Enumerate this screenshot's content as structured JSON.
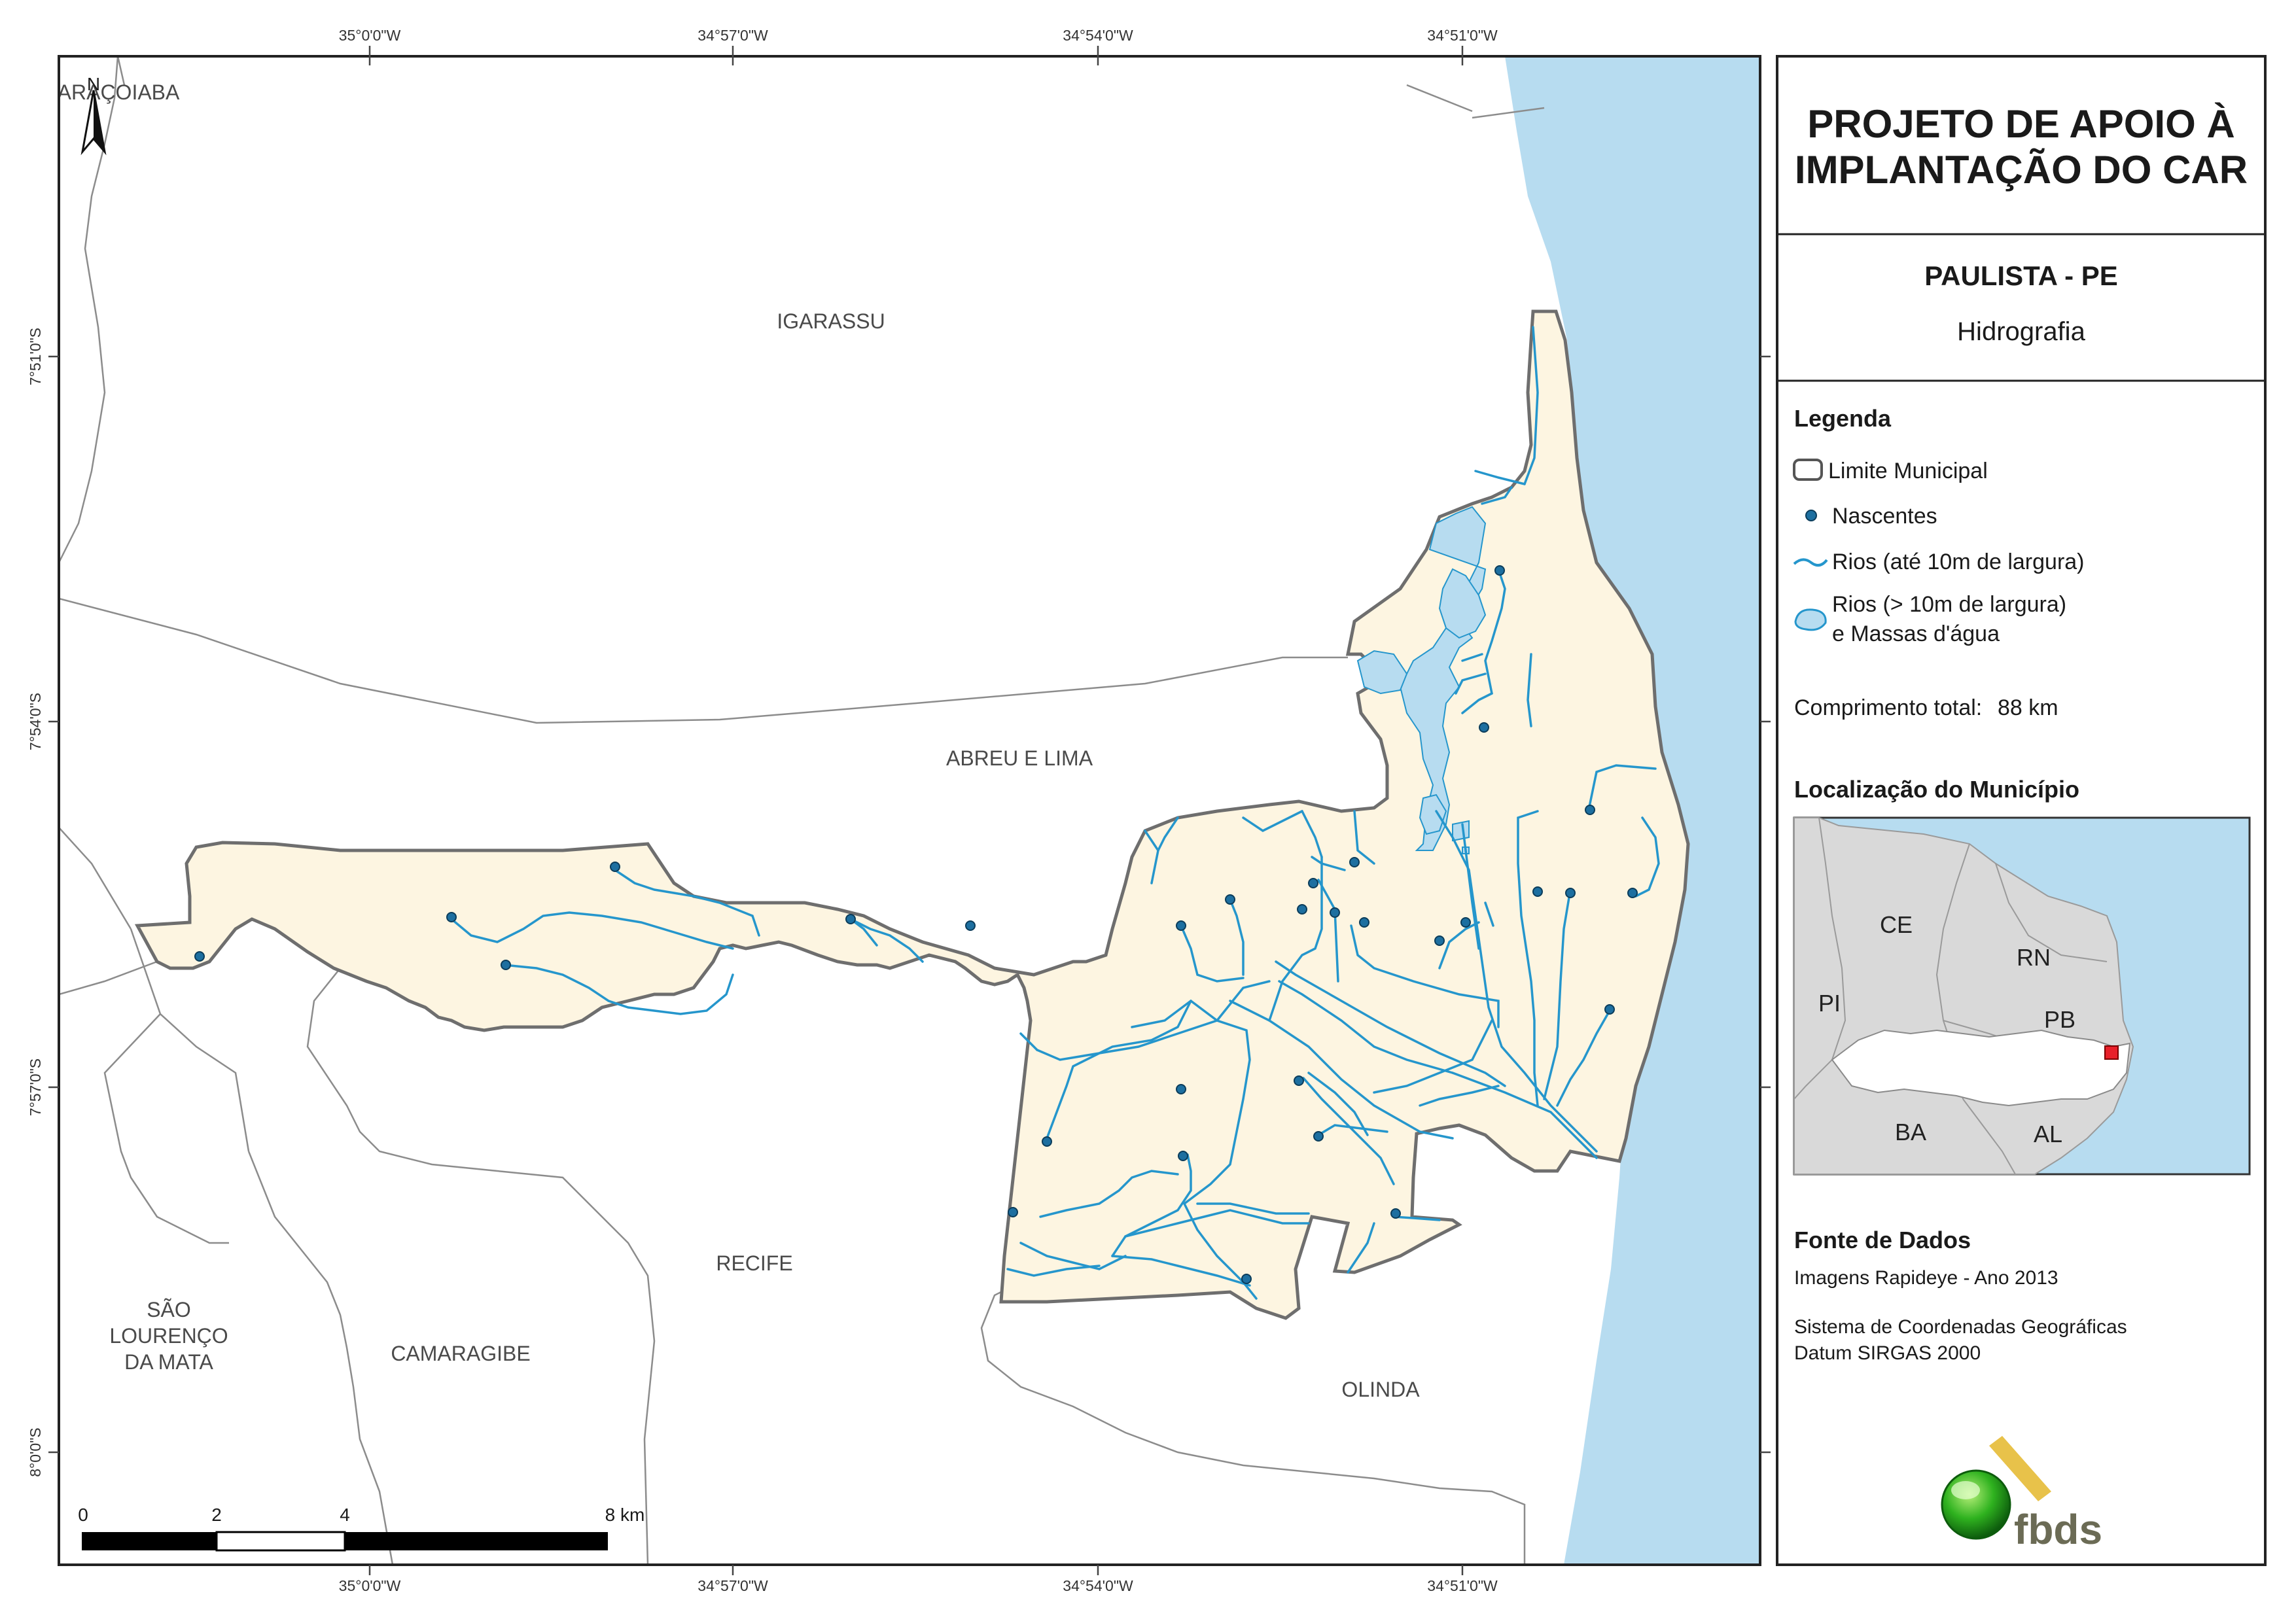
{
  "map": {
    "top_longitudes": [
      "35°0'0\"W",
      "34°57'0\"W",
      "34°54'0\"W",
      "34°51'0\"W"
    ],
    "bottom_longitudes": [
      "35°0'0\"W",
      "34°57'0\"W",
      "34°54'0\"W",
      "34°51'0\"W"
    ],
    "left_latitudes": [
      "7°51'0\"S",
      "7°54'0\"S",
      "7°57'0\"S",
      "8°0'0\"S"
    ],
    "north_label": "N",
    "municipalities": {
      "aracoiaba": "ARAÇOIABA",
      "igarassu": "IGARASSU",
      "abreu_e_lima": "ABREU E LIMA",
      "recife": "RECIFE",
      "camaragibe": "CAMARAGIBE",
      "olinda": "OLINDA",
      "sao_lourenco_1": "SÃO",
      "sao_lourenco_2": "LOURENÇO",
      "sao_lourenco_3": "DA MATA"
    },
    "scale_bar": {
      "ticks": [
        "0",
        "2",
        "4",
        "8 km"
      ]
    },
    "colors": {
      "water": "#b7dcf0",
      "municipality_fill": "#fdf5e1",
      "river": "#2596cc",
      "spring": "#1d6fa0"
    }
  },
  "panel": {
    "title_line1": "PROJETO DE APOIO À",
    "title_line2": "IMPLANTAÇÃO DO CAR",
    "municipality": "PAULISTA - PE",
    "theme": "Hidrografia",
    "legend": {
      "title": "Legenda",
      "items": {
        "limite": "Limite Municipal",
        "nascentes": "Nascentes",
        "rios_small": "Rios (até 10m de largura)",
        "rios_large_1": "Rios (> 10m de largura)",
        "rios_large_2": "e Massas d'água"
      },
      "total_length_label": "Comprimento total:",
      "total_length_value": "88 km"
    },
    "location": {
      "title": "Localização do Município",
      "states": {
        "ce": "CE",
        "rn": "RN",
        "pi": "PI",
        "pb": "PB",
        "ba": "BA",
        "al": "AL"
      }
    },
    "source": {
      "title": "Fonte de Dados",
      "line1": "Imagens Rapideye - Ano 2013",
      "line2": "Sistema de Coordenadas Geográficas",
      "line3": "Datum SIRGAS 2000"
    },
    "logo_text": "fbds"
  }
}
